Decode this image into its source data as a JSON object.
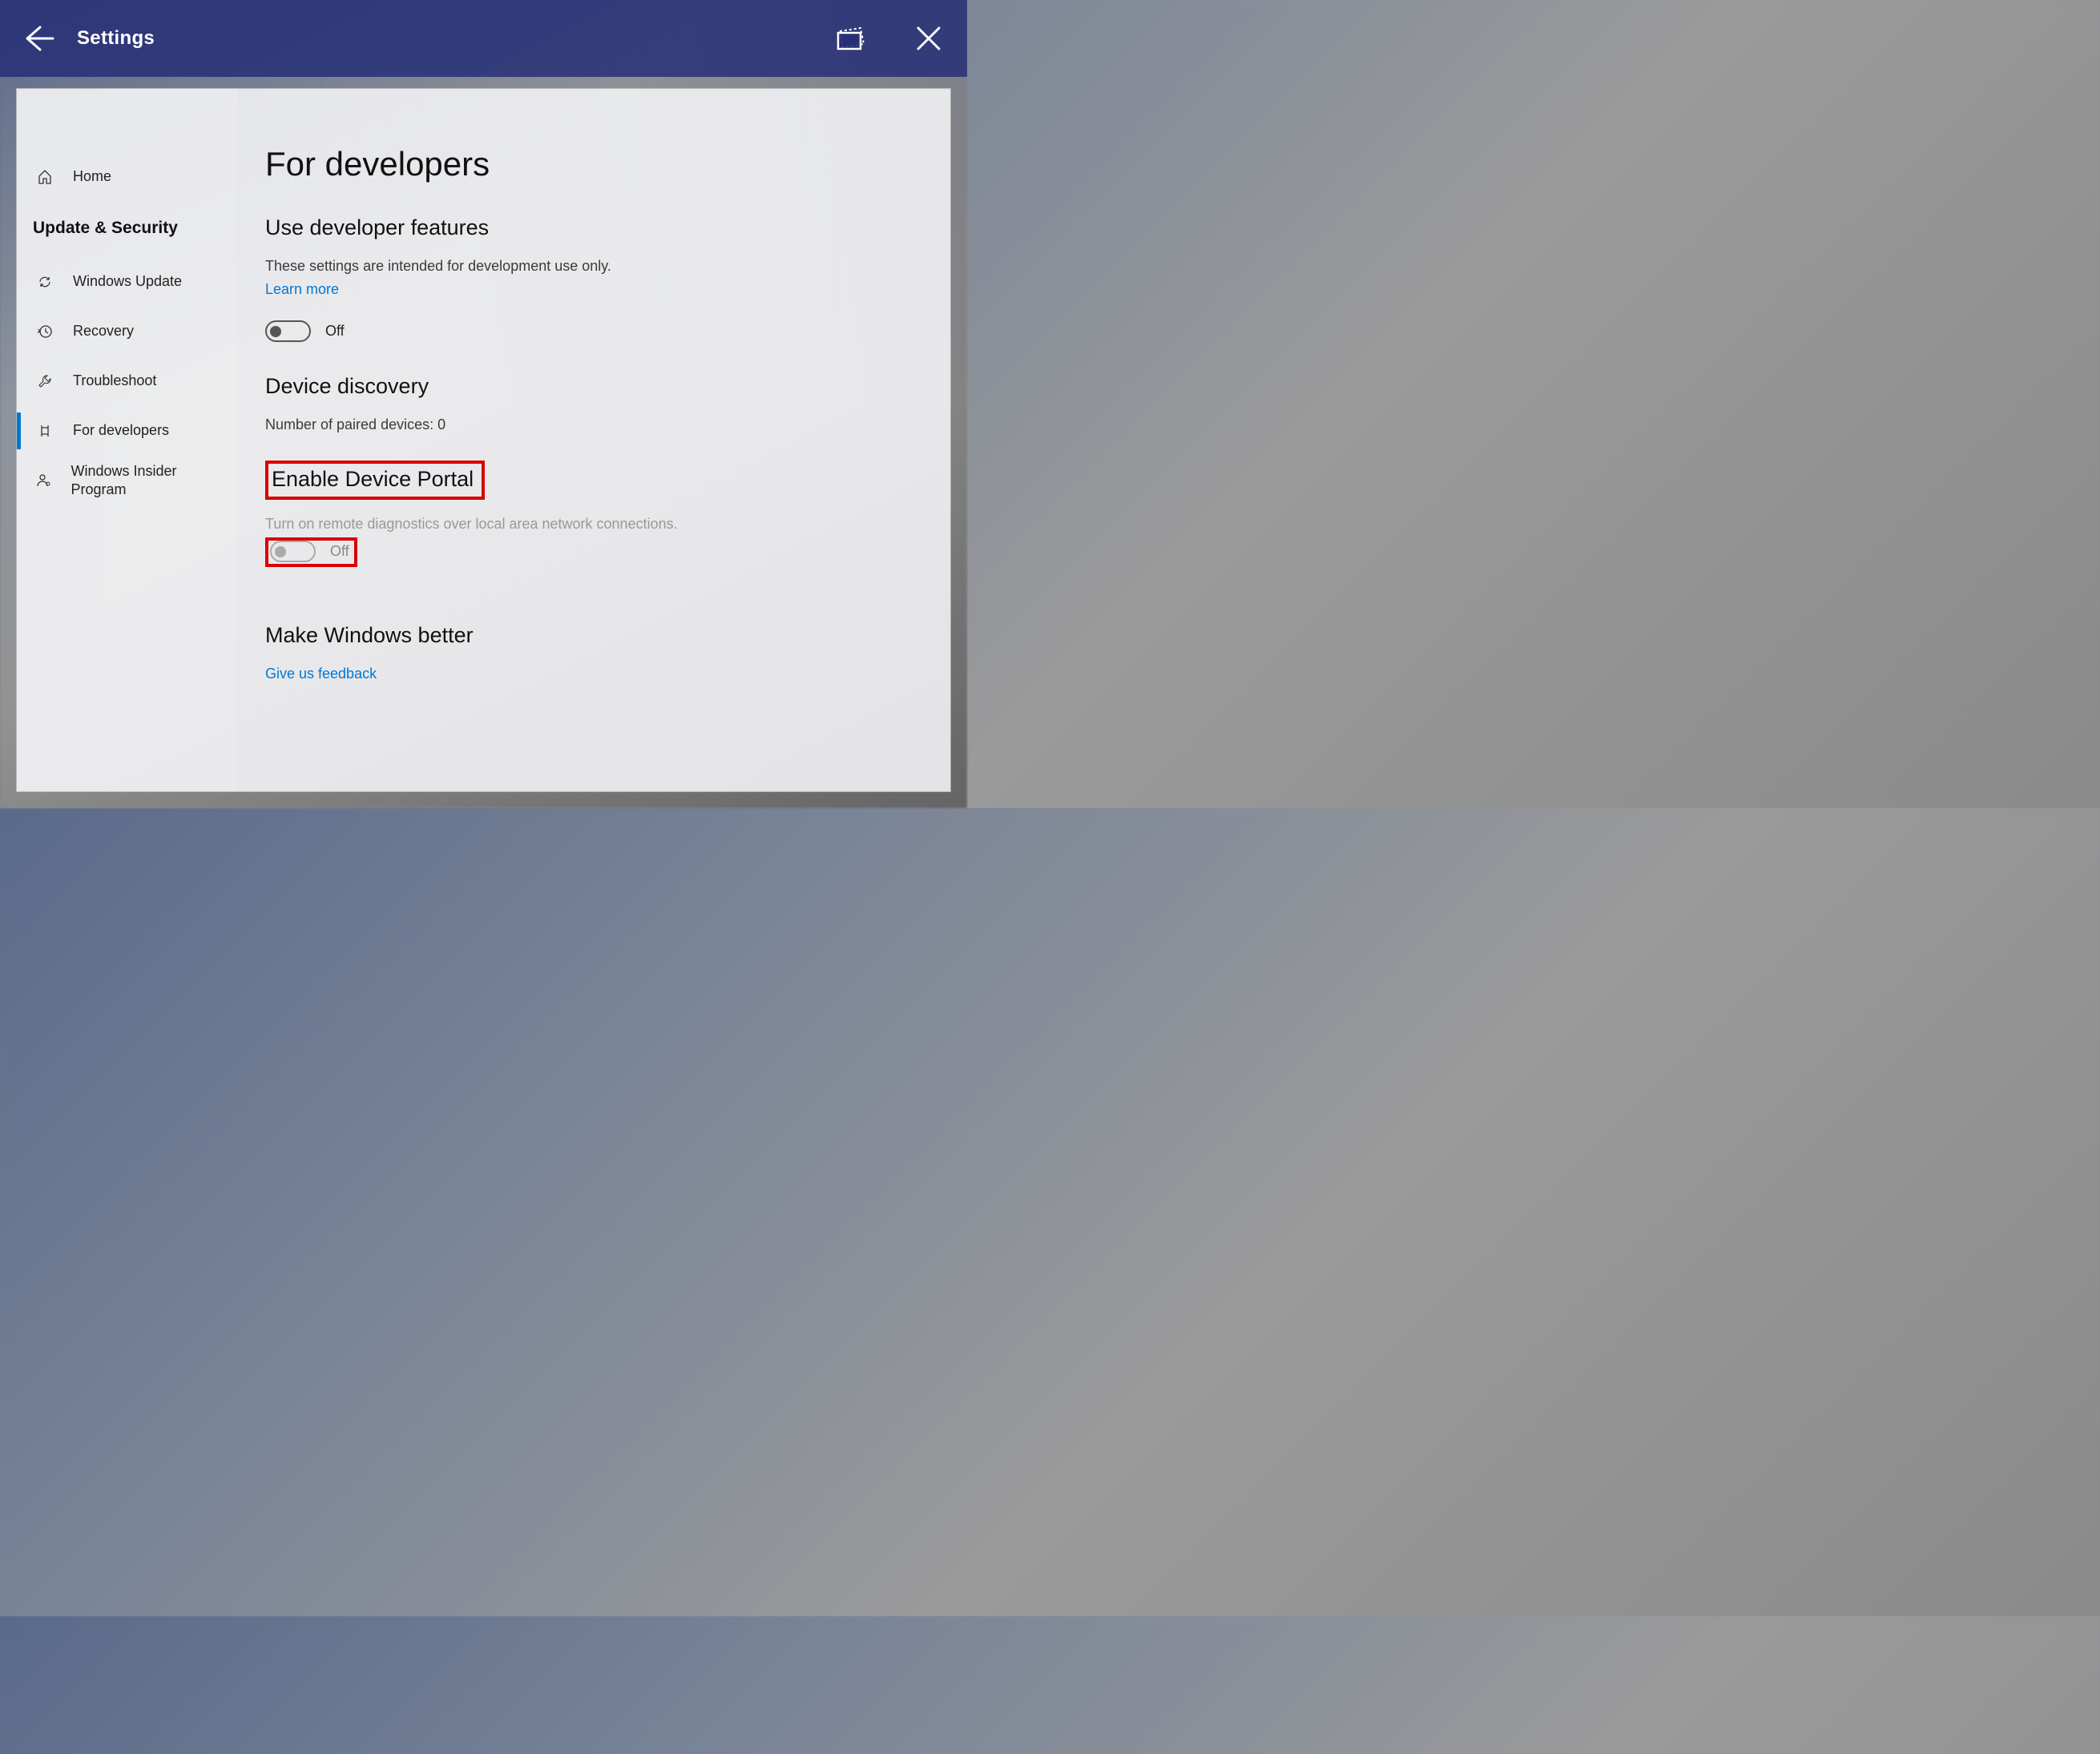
{
  "titlebar": {
    "title": "Settings"
  },
  "sidebar": {
    "home": "Home",
    "category": "Update & Security",
    "items": [
      {
        "label": "Windows Update"
      },
      {
        "label": "Recovery"
      },
      {
        "label": "Troubleshoot"
      },
      {
        "label": "For developers"
      },
      {
        "label": "Windows Insider Program"
      }
    ]
  },
  "content": {
    "page_title": "For developers",
    "sec1": {
      "heading": "Use developer features",
      "desc": "These settings are intended for development use only.",
      "link": "Learn more",
      "toggle_state": "Off"
    },
    "sec2": {
      "heading": "Device discovery",
      "paired_label": "Number of paired devices: 0"
    },
    "sec3": {
      "heading": "Enable Device Portal",
      "desc": "Turn on remote diagnostics over local area network connections.",
      "toggle_state": "Off"
    },
    "sec4": {
      "heading": "Make Windows better",
      "link": "Give us feedback"
    }
  }
}
